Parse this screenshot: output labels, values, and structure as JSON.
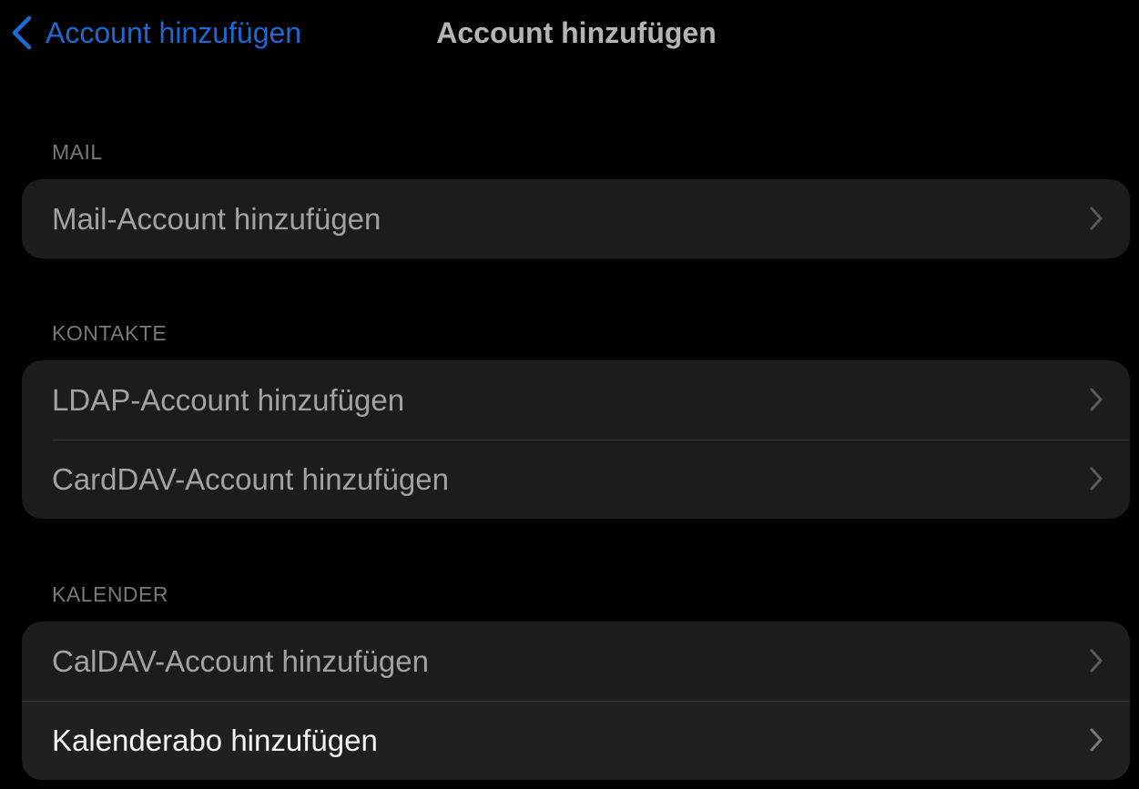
{
  "nav": {
    "back_label": "Account hinzufügen",
    "title": "Account hinzufügen"
  },
  "sections": [
    {
      "header": "MAIL",
      "items": [
        {
          "label": "Mail-Account hinzufügen"
        }
      ]
    },
    {
      "header": "KONTAKTE",
      "items": [
        {
          "label": "LDAP-Account hinzufügen"
        },
        {
          "label": "CardDAV-Account hinzufügen"
        }
      ]
    },
    {
      "header": "KALENDER",
      "items": [
        {
          "label": "CalDAV-Account hinzufügen"
        },
        {
          "label": "Kalenderabo hinzufügen"
        }
      ]
    }
  ],
  "icons": {
    "back": "chevron-left-icon",
    "disclosure": "chevron-right-icon"
  },
  "colors": {
    "background": "#000000",
    "cell_background": "#1c1c1e",
    "accent": "#1b6ad3",
    "label_dimmed": "#a2a2a6",
    "label_active": "#f4f4f6",
    "section_header": "#78787c",
    "chevron": "#5a5a5e"
  }
}
